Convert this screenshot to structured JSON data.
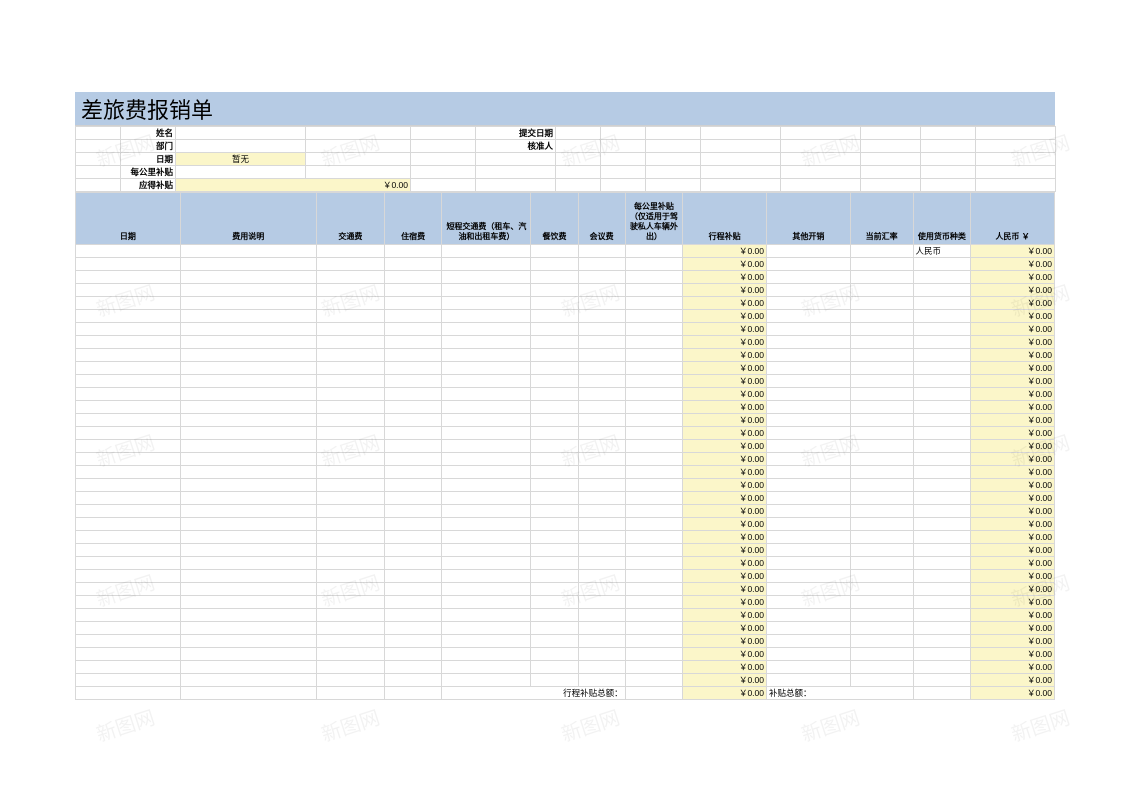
{
  "title": "差旅费报销单",
  "form": {
    "name_label": "姓名",
    "dept_label": "部门",
    "date_label": "日期",
    "date_value": "暂无",
    "perkm_label": "每公里补贴",
    "due_label": "应得补贴",
    "due_value": "￥0.00",
    "submit_date_label": "提交日期",
    "approver_label": "核准人"
  },
  "headers": {
    "c1": "日期",
    "c2": "费用说明",
    "c3": "交通费",
    "c4": "住宿费",
    "c5": "短程交通费（租车、汽油和出租车费）",
    "c6": "餐饮费",
    "c7": "会议费",
    "c8": "每公里补贴（仅适用于驾驶私人车辆外出）",
    "c9": "行程补贴",
    "c10": "其他开销",
    "c11": "当前汇率",
    "c12": "使用货币种类",
    "c13": "人民币 ￥"
  },
  "row_default": {
    "col9": "￥0.00",
    "col12_first": "人民币",
    "col13": "￥0.00"
  },
  "row_count": 34,
  "totals": {
    "trip_label": "行程补贴总额：",
    "trip_value": "￥0.00",
    "grand_label": "补贴总额：",
    "grand_value": "￥0.00"
  },
  "watermark_text": "新图网"
}
